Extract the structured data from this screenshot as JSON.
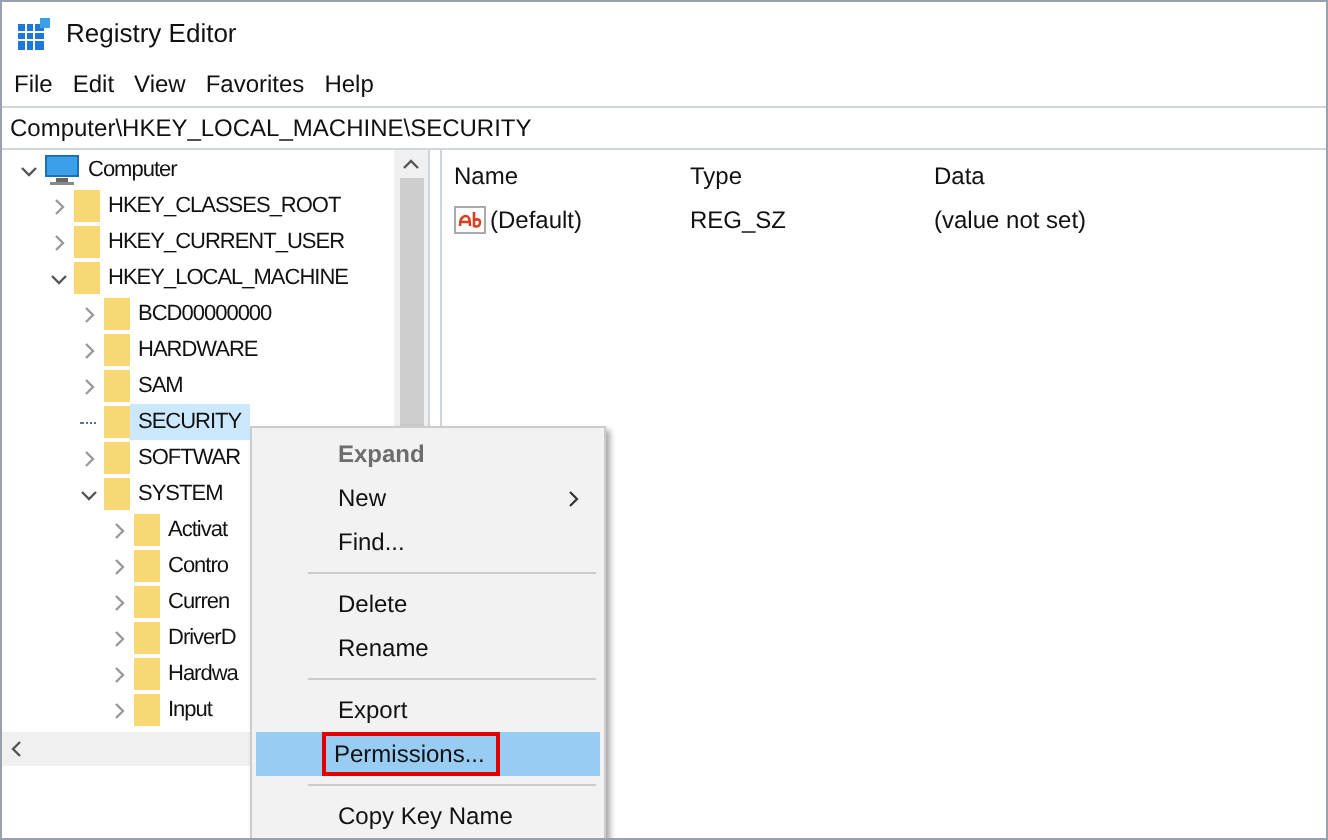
{
  "window": {
    "title": "Registry Editor"
  },
  "menu_bar": [
    "File",
    "Edit",
    "View",
    "Favorites",
    "Help"
  ],
  "address_bar": {
    "value": "Computer\\HKEY_LOCAL_MACHINE\\SECURITY"
  },
  "tree": [
    {
      "label": "Computer",
      "kind": "computer",
      "expanded": true,
      "selected": false,
      "children": [
        {
          "label": "HKEY_CLASSES_ROOT",
          "kind": "folder",
          "expanded": false,
          "selected": false
        },
        {
          "label": "HKEY_CURRENT_USER",
          "kind": "folder",
          "expanded": false,
          "selected": false
        },
        {
          "label": "HKEY_LOCAL_MACHINE",
          "kind": "folder",
          "expanded": true,
          "selected": false,
          "children": [
            {
              "label": "BCD00000000",
              "kind": "folder",
              "expanded": false,
              "selected": false
            },
            {
              "label": "HARDWARE",
              "kind": "folder",
              "expanded": false,
              "selected": false
            },
            {
              "label": "SAM",
              "kind": "folder",
              "expanded": false,
              "selected": false
            },
            {
              "label": "SECURITY",
              "kind": "leaf",
              "expanded": false,
              "selected": true
            },
            {
              "label": "SOFTWAR",
              "kind": "folder",
              "expanded": false,
              "selected": false
            },
            {
              "label": "SYSTEM",
              "kind": "folder",
              "expanded": true,
              "selected": false,
              "children": [
                {
                  "label": "Activat",
                  "kind": "folder",
                  "expanded": false,
                  "selected": false
                },
                {
                  "label": "Contro",
                  "kind": "folder",
                  "expanded": false,
                  "selected": false
                },
                {
                  "label": "Curren",
                  "kind": "folder",
                  "expanded": false,
                  "selected": false
                },
                {
                  "label": "DriverD",
                  "kind": "folder",
                  "expanded": false,
                  "selected": false
                },
                {
                  "label": "Hardwa",
                  "kind": "folder",
                  "expanded": false,
                  "selected": false
                },
                {
                  "label": "Input",
                  "kind": "folder",
                  "expanded": false,
                  "selected": false
                }
              ]
            }
          ]
        }
      ]
    }
  ],
  "values_table": {
    "columns": [
      "Name",
      "Type",
      "Data"
    ],
    "rows": [
      {
        "name": "(Default)",
        "type": "REG_SZ",
        "data": "(value not set)"
      }
    ]
  },
  "context_menu": [
    {
      "kind": "item",
      "label": "Expand",
      "disabled": true,
      "submenu": false,
      "selected": false,
      "outlined": false
    },
    {
      "kind": "item",
      "label": "New",
      "disabled": false,
      "submenu": true,
      "selected": false,
      "outlined": false
    },
    {
      "kind": "item",
      "label": "Find...",
      "disabled": false,
      "submenu": false,
      "selected": false,
      "outlined": false
    },
    {
      "kind": "separator"
    },
    {
      "kind": "item",
      "label": "Delete",
      "disabled": false,
      "submenu": false,
      "selected": false,
      "outlined": false
    },
    {
      "kind": "item",
      "label": "Rename",
      "disabled": false,
      "submenu": false,
      "selected": false,
      "outlined": false
    },
    {
      "kind": "separator"
    },
    {
      "kind": "item",
      "label": "Export",
      "disabled": false,
      "submenu": false,
      "selected": false,
      "outlined": false
    },
    {
      "kind": "item",
      "label": "Permissions...",
      "disabled": false,
      "submenu": false,
      "selected": true,
      "outlined": true
    },
    {
      "kind": "separator"
    },
    {
      "kind": "item",
      "label": "Copy Key Name",
      "disabled": false,
      "submenu": false,
      "selected": false,
      "outlined": false
    }
  ]
}
